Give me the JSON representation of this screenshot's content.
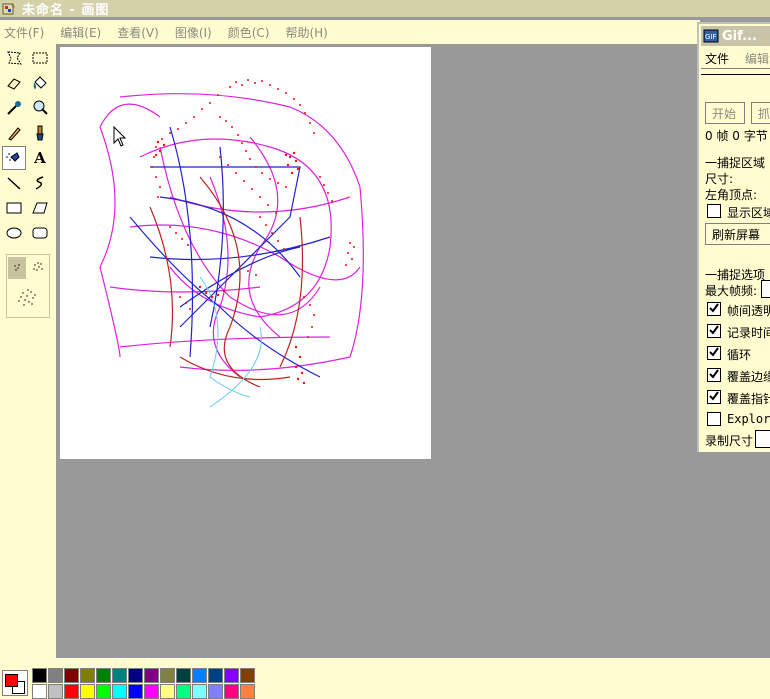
{
  "window": {
    "title": "未命名 - 画图"
  },
  "menu": [
    {
      "label": "文件(F)"
    },
    {
      "label": "编辑(E)"
    },
    {
      "label": "查看(V)"
    },
    {
      "label": "图像(I)"
    },
    {
      "label": "颜色(C)"
    },
    {
      "label": "帮助(H)"
    }
  ],
  "tools": [
    {
      "name": "free-select-icon"
    },
    {
      "name": "rect-select-icon"
    },
    {
      "name": "eraser-icon"
    },
    {
      "name": "fill-icon"
    },
    {
      "name": "color-picker-icon"
    },
    {
      "name": "magnifier-icon"
    },
    {
      "name": "pencil-icon"
    },
    {
      "name": "brush-icon"
    },
    {
      "name": "airbrush-icon"
    },
    {
      "name": "text-icon"
    },
    {
      "name": "line-icon"
    },
    {
      "name": "curve-icon"
    },
    {
      "name": "rectangle-icon"
    },
    {
      "name": "polygon-icon"
    },
    {
      "name": "ellipse-icon"
    },
    {
      "name": "rounded-rect-icon"
    }
  ],
  "text_tool_glyph": "A",
  "selected_tool": "airbrush-icon",
  "colors": {
    "foreground": "#ff0000",
    "background": "#ffffff",
    "palette_top": [
      "#000000",
      "#808080",
      "#800000",
      "#808000",
      "#008000",
      "#008080",
      "#000080",
      "#800080",
      "#808040",
      "#004040",
      "#0080ff",
      "#004080",
      "#8000ff",
      "#804000"
    ],
    "palette_bottom": [
      "#ffffff",
      "#c0c0c0",
      "#ff0000",
      "#ffff00",
      "#00ff00",
      "#00ffff",
      "#0000ff",
      "#ff00ff",
      "#ffff80",
      "#00ff80",
      "#80ffff",
      "#8080ff",
      "#ff0080",
      "#ff8040"
    ]
  },
  "gif_window": {
    "title": "Gif...",
    "menu": [
      "文件",
      "编辑"
    ],
    "start_button": "开始",
    "capture_button": "抓",
    "status": "0 帧 0 字节",
    "capture_area_label": "一捕捉区域",
    "size_label": "尺寸:",
    "corner_label": "左角顶点:",
    "show_area_label": "显示区域",
    "refresh_button": "刷新屏幕",
    "capture_options_label": "一捕捉选项",
    "max_fps_label": "最大帧频:",
    "options": [
      {
        "label": "帧间透明",
        "checked": true
      },
      {
        "label": "记录时间",
        "checked": true
      },
      {
        "label": "循环",
        "checked": true
      },
      {
        "label": "覆盖边缘",
        "checked": true
      },
      {
        "label": "覆盖指针",
        "checked": true
      },
      {
        "label": "Explorer",
        "checked": false
      }
    ],
    "record_size_label": "录制尺寸"
  }
}
